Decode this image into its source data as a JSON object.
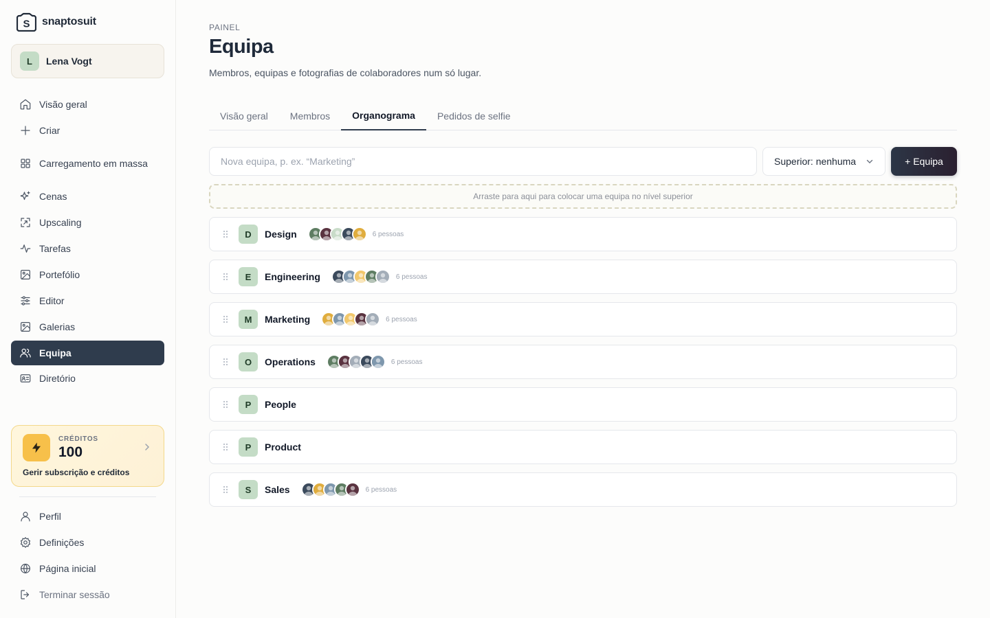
{
  "brand": {
    "name": "snaptosuit"
  },
  "user": {
    "initial": "L",
    "name": "Lena Vogt"
  },
  "nav": [
    {
      "key": "overview",
      "label": "Visão geral",
      "icon": "home-icon"
    },
    {
      "key": "create",
      "label": "Criar",
      "icon": "plus-icon"
    },
    {
      "key": "bulk",
      "label": "Carregamento em massa",
      "icon": "grid-icon"
    },
    {
      "key": "scenes",
      "label": "Cenas",
      "icon": "sparkles-icon"
    },
    {
      "key": "upscaling",
      "label": "Upscaling",
      "icon": "expand-icon"
    },
    {
      "key": "tasks",
      "label": "Tarefas",
      "icon": "activity-icon"
    },
    {
      "key": "portfolio",
      "label": "Portefólio",
      "icon": "image-icon"
    },
    {
      "key": "editor",
      "label": "Editor",
      "icon": "sliders-icon"
    },
    {
      "key": "galleries",
      "label": "Galerias",
      "icon": "gallery-icon"
    },
    {
      "key": "team",
      "label": "Equipa",
      "icon": "users-icon",
      "active": true
    },
    {
      "key": "directory",
      "label": "Diretório",
      "icon": "id-card-icon"
    }
  ],
  "credits": {
    "label": "CRÉDITOS",
    "value": "100",
    "link": "Gerir subscrição e créditos"
  },
  "nav_bottom": [
    {
      "key": "profile",
      "label": "Perfil",
      "icon": "user-icon"
    },
    {
      "key": "settings",
      "label": "Definições",
      "icon": "gear-icon"
    },
    {
      "key": "home",
      "label": "Página inicial",
      "icon": "globe-icon"
    },
    {
      "key": "logout",
      "label": "Terminar sessão",
      "icon": "logout-icon"
    }
  ],
  "page": {
    "eyebrow": "PAINEL",
    "title": "Equipa",
    "subtitle": "Membros, equipas e fotografias de colaboradores num só lugar."
  },
  "tabs": [
    {
      "label": "Visão geral",
      "active": false
    },
    {
      "label": "Membros",
      "active": false
    },
    {
      "label": "Organograma",
      "active": true
    },
    {
      "label": "Pedidos de selfie",
      "active": false
    }
  ],
  "toolbar": {
    "new_team_placeholder": "Nova equipa, p. ex. “Marketing”",
    "new_team_value": "",
    "superior_label": "Superior: nenhuma",
    "add_label": "+ Equipa"
  },
  "dropzone": {
    "text": "Arraste para aqui para colocar uma equipa no nível superior"
  },
  "colors": {
    "accent": "#2f3c4d",
    "badge": "#c4dcc6",
    "avatar_palette": [
      "#5e7d62",
      "#5a3340",
      "#c9dcc9",
      "#3b4a5c",
      "#e0ad3e",
      "#7e97ad",
      "#f2c86c",
      "#a3adb8"
    ]
  },
  "teams": [
    {
      "initial": "D",
      "name": "Design",
      "count": "6 pessoas",
      "avatars": [
        0,
        1,
        2,
        3,
        4
      ]
    },
    {
      "initial": "E",
      "name": "Engineering",
      "count": "6 pessoas",
      "avatars": [
        3,
        5,
        6,
        0,
        7
      ]
    },
    {
      "initial": "M",
      "name": "Marketing",
      "count": "6 pessoas",
      "avatars": [
        4,
        5,
        6,
        1,
        7
      ]
    },
    {
      "initial": "O",
      "name": "Operations",
      "count": "6 pessoas",
      "avatars": [
        0,
        1,
        7,
        3,
        5
      ]
    },
    {
      "initial": "P",
      "name": "People",
      "count": "",
      "avatars": []
    },
    {
      "initial": "P",
      "name": "Product",
      "count": "",
      "avatars": []
    },
    {
      "initial": "S",
      "name": "Sales",
      "count": "6 pessoas",
      "avatars": [
        3,
        4,
        5,
        0,
        1
      ]
    }
  ]
}
